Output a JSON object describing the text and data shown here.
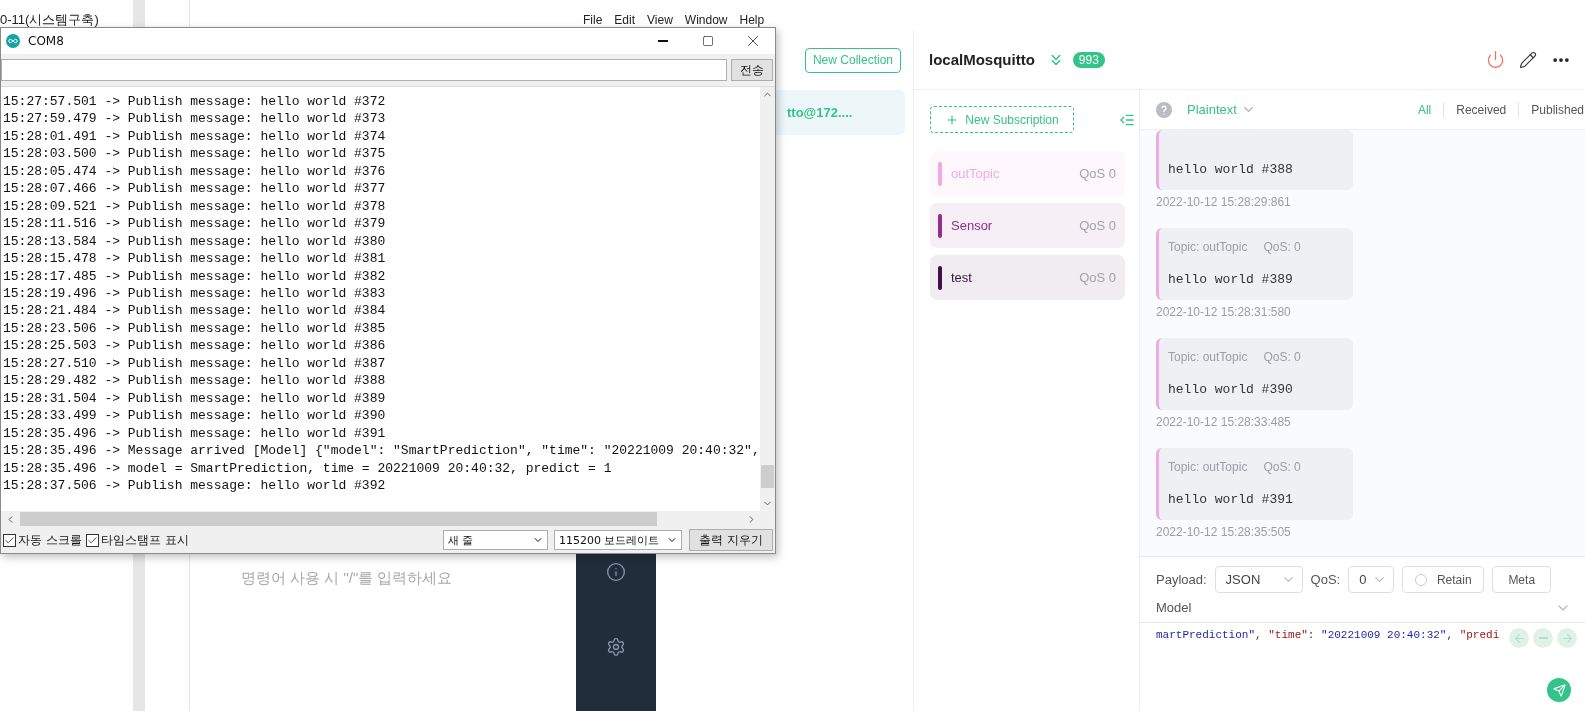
{
  "web_page": {
    "sidebar_title": "0-11(시스템구축)",
    "editor_placeholder": "명령어 사용 시 \"/\"를 입력하세요"
  },
  "mqttx": {
    "menu": [
      "File",
      "Edit",
      "View",
      "Window",
      "Help"
    ],
    "new_collection": "New Collection",
    "connection_item": {
      "label": "tto@172....",
      "selected": true
    },
    "connection": {
      "name": "localMosquitto",
      "count": "993"
    },
    "new_subscription": "New Subscription",
    "subscriptions": [
      {
        "topic": "outTopic",
        "qos": "QoS 0",
        "color": "#eeaae6"
      },
      {
        "topic": "Sensor",
        "qos": "QoS 0",
        "color": "#952d8a"
      },
      {
        "topic": "test",
        "qos": "QoS 0",
        "color": "#3c1342"
      }
    ],
    "payload_format": "Plaintext",
    "filters": [
      {
        "label": "All",
        "selected": true
      },
      {
        "label": "Received",
        "selected": false
      },
      {
        "label": "Published",
        "selected": false
      }
    ],
    "messages": [
      {
        "payload": "hello world #388",
        "time": "2022-10-12 15:28:29:861"
      },
      {
        "topic": "Topic: outTopic",
        "qos": "QoS: 0",
        "payload": "hello world #389",
        "time": "2022-10-12 15:28:31:580"
      },
      {
        "topic": "Topic: outTopic",
        "qos": "QoS: 0",
        "payload": "hello world #390",
        "time": "2022-10-12 15:28:33:485"
      },
      {
        "topic": "Topic: outTopic",
        "qos": "QoS: 0",
        "payload": "hello world #391",
        "time": "2022-10-12 15:28:35:505"
      }
    ],
    "publish": {
      "payload_label": "Payload:",
      "payload_type": "JSON",
      "qos_label": "QoS:",
      "qos": "0",
      "retain": {
        "label": "Retain",
        "checked": false
      },
      "meta": "Meta",
      "topic": "Model",
      "code": [
        {
          "text": "martPrediction\"",
          "kind": "string"
        },
        {
          "text": ", ",
          "kind": "punct"
        },
        {
          "text": "\"time\"",
          "kind": "key"
        },
        {
          "text": ": ",
          "kind": "punct"
        },
        {
          "text": "\"20221009 20:40:32\"",
          "kind": "string"
        },
        {
          "text": ", ",
          "kind": "punct"
        },
        {
          "text": "\"predi",
          "kind": "key"
        }
      ]
    }
  },
  "serial_monitor": {
    "title": "COM8",
    "send": "전송",
    "lines": [
      "15:27:57.501 -> Publish message: hello world #372",
      "15:27:59.479 -> Publish message: hello world #373",
      "15:28:01.491 -> Publish message: hello world #374",
      "15:28:03.500 -> Publish message: hello world #375",
      "15:28:05.474 -> Publish message: hello world #376",
      "15:28:07.466 -> Publish message: hello world #377",
      "15:28:09.521 -> Publish message: hello world #378",
      "15:28:11.516 -> Publish message: hello world #379",
      "15:28:13.584 -> Publish message: hello world #380",
      "15:28:15.478 -> Publish message: hello world #381",
      "15:28:17.485 -> Publish message: hello world #382",
      "15:28:19.496 -> Publish message: hello world #383",
      "15:28:21.484 -> Publish message: hello world #384",
      "15:28:23.506 -> Publish message: hello world #385",
      "15:28:25.503 -> Publish message: hello world #386",
      "15:28:27.510 -> Publish message: hello world #387",
      "15:28:29.482 -> Publish message: hello world #388",
      "15:28:31.504 -> Publish message: hello world #389",
      "15:28:33.499 -> Publish message: hello world #390",
      "15:28:35.496 -> Publish message: hello world #391",
      "15:28:35.496 -> Message arrived [Model] {\"model\": \"SmartPrediction\", \"time\": \"20221009 20:40:32\",",
      "15:28:35.496 -> model = SmartPrediction, time = 20221009 20:40:32, predict = 1",
      "15:28:37.506 -> Publish message: hello world #392"
    ],
    "auto_scroll": {
      "label": "자동 스크롤",
      "checked": true
    },
    "timestamp": {
      "label": "타임스탬프 표시",
      "checked": true
    },
    "line_ending": "새 줄",
    "baud": "115200 보드레이트",
    "clear": "출력 지우기"
  }
}
